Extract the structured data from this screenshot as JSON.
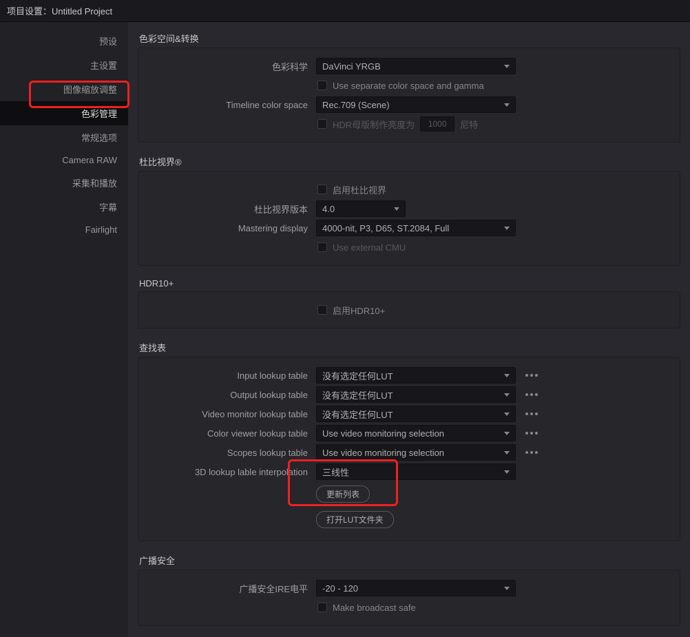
{
  "window_title": "项目设置：Untitled Project",
  "sidebar": {
    "items": [
      {
        "label": "预设"
      },
      {
        "label": "主设置"
      },
      {
        "label": "图像缩放调整"
      },
      {
        "label": "色彩管理"
      },
      {
        "label": "常规选项"
      },
      {
        "label": "Camera RAW"
      },
      {
        "label": "采集和播放"
      },
      {
        "label": "字幕"
      },
      {
        "label": "Fairlight"
      }
    ],
    "active_index": 3
  },
  "sections": {
    "color_space": {
      "title": "色彩空间&转换",
      "color_science_label": "色彩科学",
      "color_science_value": "DaVinci YRGB",
      "separate_color_label": "Use separate color space and gamma",
      "timeline_label": "Timeline color space",
      "timeline_value": "Rec.709 (Scene)",
      "hdr_master_label": "HDR母版制作亮度为",
      "hdr_master_value": "1000",
      "hdr_master_unit": "尼特"
    },
    "dolby": {
      "title": "杜比视界®",
      "enable_label": "启用杜比视界",
      "version_label": "杜比视界版本",
      "version_value": "4.0",
      "mastering_label": "Mastering display",
      "mastering_value": "4000-nit, P3, D65, ST.2084, Full",
      "external_cmu_label": "Use external CMU"
    },
    "hdr10": {
      "title": "HDR10+",
      "enable_label": "启用HDR10+"
    },
    "lut": {
      "title": "查找表",
      "input_label": "Input lookup table",
      "output_label": "Output lookup table",
      "video_monitor_label": "Video monitor lookup table",
      "color_viewer_label": "Color viewer lookup table",
      "scopes_label": "Scopes lookup table",
      "interp_label": "3D lookup lable interpolation",
      "no_lut": "没有选定任何LUT",
      "use_vm": "Use video monitoring selection",
      "trilinear": "三线性",
      "refresh_btn": "更新列表",
      "open_folder_btn": "打开LUT文件夹"
    },
    "broadcast": {
      "title": "广播安全",
      "ire_label": "广播安全IRE电平",
      "ire_value": "-20 - 120",
      "make_safe_label": "Make broadcast safe"
    }
  }
}
